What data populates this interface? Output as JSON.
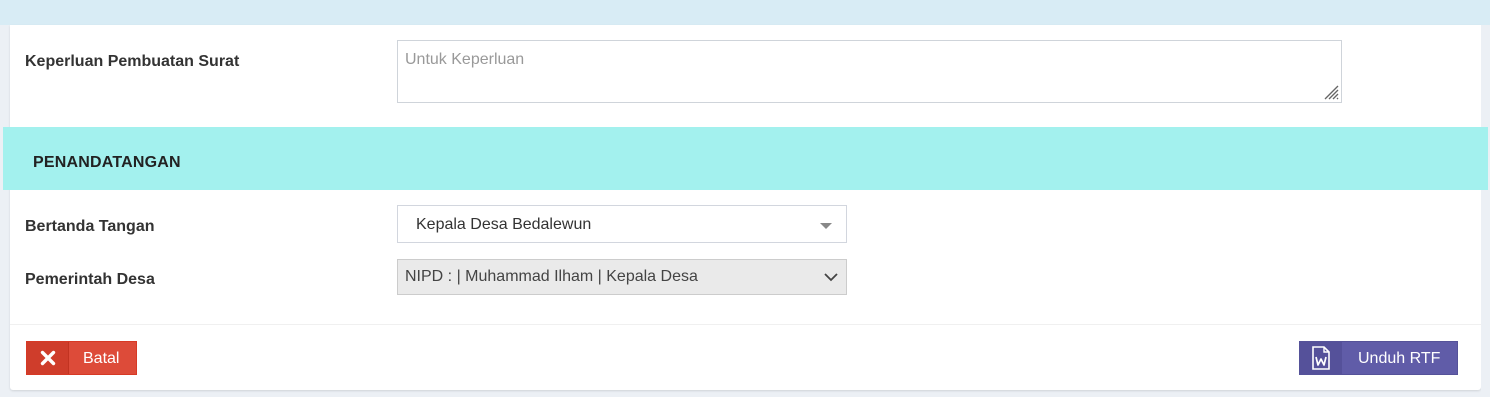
{
  "form": {
    "keperluan_label": "Keperluan Pembuatan Surat",
    "keperluan_placeholder": "Untuk Keperluan",
    "keperluan_value": ""
  },
  "section": {
    "title": "PENANDATANGAN"
  },
  "signer": {
    "bertanda_label": "Bertanda Tangan",
    "bertanda_value": "Kepala Desa Bedalewun",
    "pemerintah_label": "Pemerintah Desa",
    "pemerintah_value": "NIPD : | Muhammad Ilham | Kepala Desa"
  },
  "actions": {
    "cancel_label": "Batal",
    "download_label": "Unduh RTF"
  },
  "colors": {
    "top_band": "#d8ecf5",
    "section_header": "#a3f1ee",
    "cancel_button": "#dd4b39",
    "download_button": "#605ca8"
  },
  "icons": {
    "cancel": "close-icon",
    "download": "word-document-icon",
    "select_caret": "caret-down-icon",
    "select_chevron": "chevron-down-icon",
    "resize": "resize-grip-icon"
  }
}
